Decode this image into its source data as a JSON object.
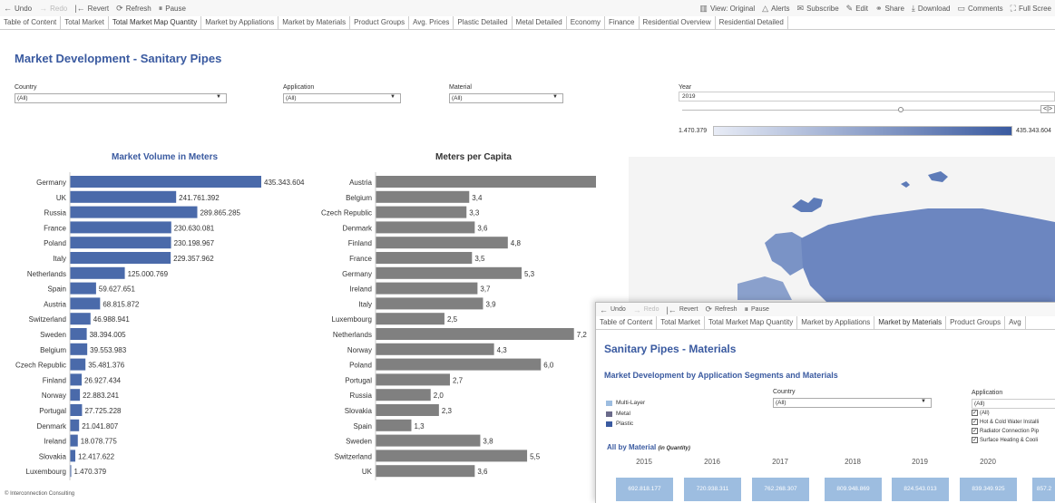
{
  "toolbar": {
    "undo": "Undo",
    "redo": "Redo",
    "revert": "Revert",
    "refresh": "Refresh",
    "pause": "Pause",
    "view": "View: Original",
    "alerts": "Alerts",
    "subscribe": "Subscribe",
    "edit": "Edit",
    "share": "Share",
    "download": "Download",
    "comments": "Comments",
    "fullscreen": "Full Scree"
  },
  "tabs": [
    "Table of Content",
    "Total Market",
    "Total Market Map Quantity",
    "Market by Appliations",
    "Market by Materials",
    "Product Groups",
    "Avg. Prices",
    "Plastic Detailed",
    "Metal Detailed",
    "Economy",
    "Finance",
    "Residential Overview",
    "Residential Detailed"
  ],
  "active_tab": "Total Market Map Quantity",
  "page_title": "Market Development - Sanitary Pipes",
  "filters": {
    "country_label": "Country",
    "country_value": "(All)",
    "application_label": "Application",
    "application_value": "(All)",
    "material_label": "Material",
    "material_value": "(All)",
    "year_label": "Year",
    "year_value": "2019"
  },
  "legend": {
    "min": "1.470.379",
    "max": "435.343.604"
  },
  "chart_data": [
    {
      "type": "bar",
      "title": "Market Volume in Meters",
      "categories": [
        "Germany",
        "UK",
        "Russia",
        "France",
        "Poland",
        "Italy",
        "Netherlands",
        "Spain",
        "Austria",
        "Switzerland",
        "Sweden",
        "Belgium",
        "Czech Republic",
        "Finland",
        "Norway",
        "Portugal",
        "Denmark",
        "Ireland",
        "Slovakia",
        "Luxembourg"
      ],
      "values": [
        435343604,
        241761392,
        289865285,
        230630081,
        230198967,
        229357962,
        125000769,
        59627651,
        68815872,
        46988941,
        38394005,
        39553983,
        35481376,
        26927434,
        22883241,
        27725228,
        21041807,
        18078775,
        12417622,
        1470379
      ],
      "labels": [
        "435.343.604",
        "241.761.392",
        "289.865.285",
        "230.630.081",
        "230.198.967",
        "229.357.962",
        "125.000.769",
        "59.627.651",
        "68.815.872",
        "46.988.941",
        "38.394.005",
        "39.553.983",
        "35.481.376",
        "26.927.434",
        "22.883.241",
        "27.725.228",
        "21.041.807",
        "18.078.775",
        "12.417.622",
        "1.470.379"
      ],
      "color": "#4a6aaa"
    },
    {
      "type": "bar",
      "title": "Meters per Capita",
      "categories": [
        "Austria",
        "Belgium",
        "Czech Republic",
        "Denmark",
        "Finland",
        "France",
        "Germany",
        "Ireland",
        "Italy",
        "Luxembourg",
        "Netherlands",
        "Norway",
        "Poland",
        "Portugal",
        "Russia",
        "Slovakia",
        "Spain",
        "Sweden",
        "Switzerland",
        "UK"
      ],
      "values": [
        8.0,
        3.4,
        3.3,
        3.6,
        4.8,
        3.5,
        5.3,
        3.7,
        3.9,
        2.5,
        7.2,
        4.3,
        6.0,
        2.7,
        2.0,
        2.3,
        1.3,
        3.8,
        5.5,
        3.6
      ],
      "labels": [
        "8,0",
        "3,4",
        "3,3",
        "3,6",
        "4,8",
        "3,5",
        "5,3",
        "3,7",
        "3,9",
        "2,5",
        "7,2",
        "4,3",
        "6,0",
        "2,7",
        "2,0",
        "2,3",
        "1,3",
        "3,8",
        "5,5",
        "3,6"
      ],
      "color": "#808080"
    }
  ],
  "copyright": "© Interconnection Consulting",
  "overlay": {
    "tabs": [
      "Table of Content",
      "Total Market",
      "Total Market Map Quantity",
      "Market by Appliations",
      "Market by Materials",
      "Product Groups",
      "Avg"
    ],
    "active_tab": "Market by Materials",
    "title": "Sanitary Pipes - Materials",
    "subtitle": "Market Development by Application Segments and Materials",
    "country_label": "Country",
    "country_value": "(All)",
    "application_label": "Application",
    "application_value": "(All)",
    "legend": [
      {
        "name": "Multi-Layer",
        "color": "#9dbde0"
      },
      {
        "name": "Metal",
        "color": "#6a6a8a"
      },
      {
        "name": "Plastic",
        "color": "#3a5aa0"
      }
    ],
    "app_options": [
      "(All)",
      "Hot & Cold Water Installi",
      "Radiator Connection Pip",
      "Surface Heating & Cooli"
    ],
    "all_by_material": "All by Material",
    "in_quantity": "(in Quantity)",
    "years": [
      "2015",
      "2016",
      "2017",
      "2018",
      "2019",
      "2020",
      "20"
    ],
    "values": [
      "692.818.177",
      "720.938.311",
      "762.268.307",
      "809.948.869",
      "824.543.013",
      "839.349.925",
      "857.2"
    ]
  }
}
